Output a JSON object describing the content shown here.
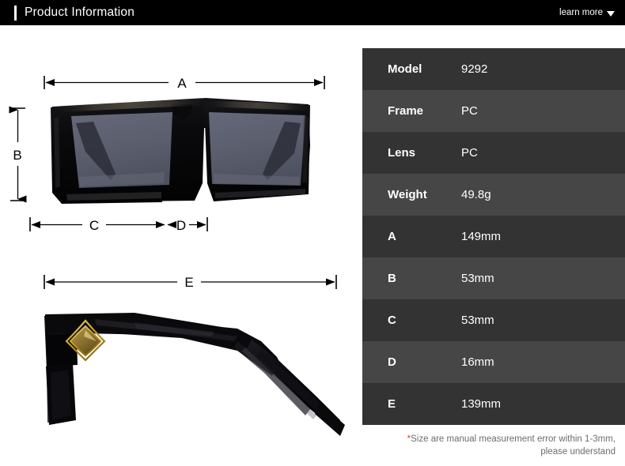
{
  "header": {
    "title": "Product Information",
    "learn_more_label": "learn more",
    "caret_icon": "chevron-down-icon",
    "background_color": "#000000",
    "text_color": "#ffffff"
  },
  "diagram": {
    "front_view_alt": "black square-frame sunglasses front view with dark gray-blue lenses",
    "side_view_alt": "black sunglasses side view with gold diamond temple ornament",
    "labels": {
      "a": "A",
      "b": "B",
      "c": "C",
      "d": "D",
      "e": "E"
    },
    "colors": {
      "frame": "#0b0b0c",
      "lens": "#5b5e6d",
      "ornament_gold": "#c9a227",
      "dimension_line": "#000000"
    }
  },
  "spec_table": {
    "rows": [
      {
        "label": "Model",
        "value": "9292"
      },
      {
        "label": "Frame",
        "value": "PC"
      },
      {
        "label": "Lens",
        "value": "PC"
      },
      {
        "label": "Weight",
        "value": "49.8g"
      },
      {
        "label": "A",
        "value": "149mm"
      },
      {
        "label": "B",
        "value": "53mm"
      },
      {
        "label": "C",
        "value": "53mm"
      },
      {
        "label": "D",
        "value": "16mm"
      },
      {
        "label": "E",
        "value": "139mm"
      }
    ],
    "row_color_odd": "#333333",
    "row_color_even": "#464646"
  },
  "footnote": {
    "star": "*",
    "line1": "Size are manual measurement error within 1-3mm,",
    "line2": "please understand",
    "star_color": "#e03a30",
    "text_color": "#6d6d6d"
  }
}
